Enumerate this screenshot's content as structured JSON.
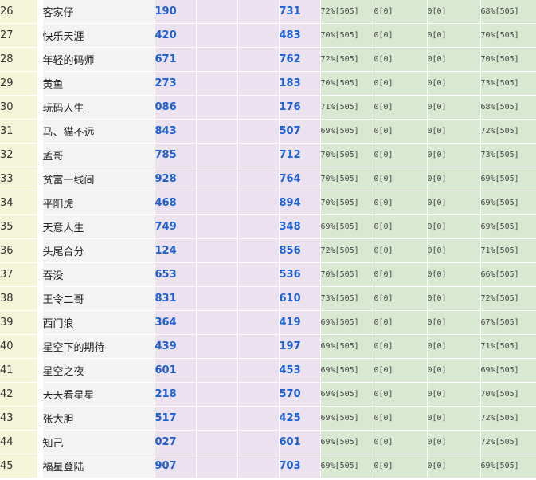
{
  "rows": [
    {
      "no": "26",
      "name": "客家仔",
      "n1": "190",
      "n2": "731",
      "s1": "72%[505]",
      "z1": "0[0]",
      "z2": "0[0]",
      "s2": "68%[505]"
    },
    {
      "no": "27",
      "name": "快乐天涯",
      "n1": "420",
      "n2": "483",
      "s1": "70%[505]",
      "z1": "0[0]",
      "z2": "0[0]",
      "s2": "70%[505]"
    },
    {
      "no": "28",
      "name": "年轻的码师",
      "n1": "671",
      "n2": "762",
      "s1": "72%[505]",
      "z1": "0[0]",
      "z2": "0[0]",
      "s2": "70%[505]"
    },
    {
      "no": "29",
      "name": "黄鱼",
      "n1": "273",
      "n2": "183",
      "s1": "70%[505]",
      "z1": "0[0]",
      "z2": "0[0]",
      "s2": "73%[505]"
    },
    {
      "no": "30",
      "name": "玩码人生",
      "n1": "086",
      "n2": "176",
      "s1": "71%[505]",
      "z1": "0[0]",
      "z2": "0[0]",
      "s2": "68%[505]"
    },
    {
      "no": "31",
      "name": "马、猫不远",
      "n1": "843",
      "n2": "507",
      "s1": "69%[505]",
      "z1": "0[0]",
      "z2": "0[0]",
      "s2": "72%[505]"
    },
    {
      "no": "32",
      "name": "孟哥",
      "n1": "785",
      "n2": "712",
      "s1": "70%[505]",
      "z1": "0[0]",
      "z2": "0[0]",
      "s2": "73%[505]"
    },
    {
      "no": "33",
      "name": "贫富一线间",
      "n1": "928",
      "n2": "764",
      "s1": "70%[505]",
      "z1": "0[0]",
      "z2": "0[0]",
      "s2": "69%[505]"
    },
    {
      "no": "34",
      "name": "平阳虎",
      "n1": "468",
      "n2": "894",
      "s1": "70%[505]",
      "z1": "0[0]",
      "z2": "0[0]",
      "s2": "69%[505]"
    },
    {
      "no": "35",
      "name": "天意人生",
      "n1": "749",
      "n2": "348",
      "s1": "69%[505]",
      "z1": "0[0]",
      "z2": "0[0]",
      "s2": "69%[505]"
    },
    {
      "no": "36",
      "name": "头尾合分",
      "n1": "124",
      "n2": "856",
      "s1": "72%[505]",
      "z1": "0[0]",
      "z2": "0[0]",
      "s2": "71%[505]"
    },
    {
      "no": "37",
      "name": "吞没",
      "n1": "653",
      "n2": "536",
      "s1": "70%[505]",
      "z1": "0[0]",
      "z2": "0[0]",
      "s2": "66%[505]"
    },
    {
      "no": "38",
      "name": "王令二哥",
      "n1": "831",
      "n2": "610",
      "s1": "73%[505]",
      "z1": "0[0]",
      "z2": "0[0]",
      "s2": "72%[505]"
    },
    {
      "no": "39",
      "name": "西门浪",
      "n1": "364",
      "n2": "419",
      "s1": "69%[505]",
      "z1": "0[0]",
      "z2": "0[0]",
      "s2": "67%[505]"
    },
    {
      "no": "40",
      "name": "星空下的期待",
      "n1": "439",
      "n2": "197",
      "s1": "69%[505]",
      "z1": "0[0]",
      "z2": "0[0]",
      "s2": "71%[505]"
    },
    {
      "no": "41",
      "name": "星空之夜",
      "n1": "601",
      "n2": "453",
      "s1": "69%[505]",
      "z1": "0[0]",
      "z2": "0[0]",
      "s2": "69%[505]"
    },
    {
      "no": "42",
      "name": "天天看星星",
      "n1": "218",
      "n2": "570",
      "s1": "69%[505]",
      "z1": "0[0]",
      "z2": "0[0]",
      "s2": "70%[505]"
    },
    {
      "no": "43",
      "name": "张大胆",
      "n1": "517",
      "n2": "425",
      "s1": "69%[505]",
      "z1": "0[0]",
      "z2": "0[0]",
      "s2": "72%[505]"
    },
    {
      "no": "44",
      "name": "知己",
      "n1": "027",
      "n2": "601",
      "s1": "69%[505]",
      "z1": "0[0]",
      "z2": "0[0]",
      "s2": "72%[505]"
    },
    {
      "no": "45",
      "name": "福星登陆",
      "n1": "907",
      "n2": "703",
      "s1": "69%[505]",
      "z1": "0[0]",
      "z2": "0[0]",
      "s2": "69%[505]"
    }
  ]
}
